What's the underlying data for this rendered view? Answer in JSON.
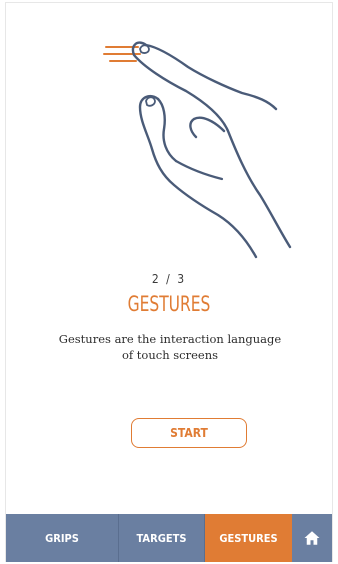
{
  "step": {
    "counter": "2 / 3"
  },
  "section": {
    "title": "GESTURES",
    "description_line1": "Gestures are the interaction language",
    "description_line2": "of touch screens"
  },
  "actions": {
    "start_label": "START"
  },
  "tabs": [
    {
      "label": "GRIPS",
      "active": false
    },
    {
      "label": "TARGETS",
      "active": false
    },
    {
      "label": "GESTURES",
      "active": true
    }
  ],
  "home_tab": {
    "icon": "home-icon"
  },
  "illustration": {
    "icon": "swipe-hand-illustration"
  },
  "colors": {
    "accent": "#e07c34",
    "tab_background": "#6a7fa1",
    "line_art": "#4a5b78"
  }
}
